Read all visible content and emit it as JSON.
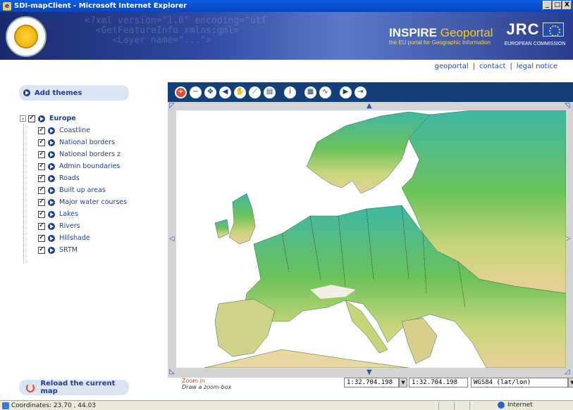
{
  "window": {
    "title": "SDI-mapClient - Microsoft Internet Explorer",
    "buttons": [
      "_",
      "□",
      "X"
    ]
  },
  "banner": {
    "xml_text": "<?xml version=\"1.0\" encoding=\"utf\n  <GetFeatureInfo xmlns:gml=\n     <Layer name=\"...\">",
    "title_inspire": "INSPIRE",
    "title_geoportal": "Geoportal",
    "tagline": "the EU portal for Geographic Information",
    "jrc": "JRC",
    "commission": "EUROPEAN COMMISSION"
  },
  "top_links": {
    "items": [
      "geoportal",
      "contact",
      "legal notice"
    ],
    "separator": "|"
  },
  "left_panel": {
    "add_themes_label": "Add themes",
    "root": {
      "expander": "-",
      "label": "Europe"
    },
    "layers": [
      "Coastline",
      "National borders",
      "National borders z",
      "Admin boundaries",
      "Roads",
      "Built up areas",
      "Major water courses",
      "Lakes",
      "Rivers",
      "Hillshade",
      "SRTM"
    ],
    "reload_label": "Reload the current map"
  },
  "toolbar": {
    "tools": [
      "zoom-in",
      "zoom-out",
      "zoom-full",
      "back",
      "pan",
      "measure",
      "print",
      "info",
      "table",
      "graph",
      "next",
      "export"
    ],
    "active_tool": "zoom-in"
  },
  "map": {
    "nav_arrows": {
      "up": "▲",
      "down": "▼",
      "left": "◁",
      "right": "▷"
    },
    "tool_title": "Zoom in",
    "tool_hint": "Draw a zoom-box"
  },
  "scale": {
    "scale_select": "1:32.704.198",
    "scale_value": "1:32.704.198",
    "crs": "WGS84 (lat/lon)"
  },
  "statusbar": {
    "coordinates": "Coordinates: 23.70 , 44.03",
    "zone": "Internet"
  },
  "colors": {
    "toolbar_bg": "#14407a",
    "accent_red": "#e04a2c",
    "link_blue": "#1e4aa0",
    "panel_bg": "#dbe4f2"
  }
}
